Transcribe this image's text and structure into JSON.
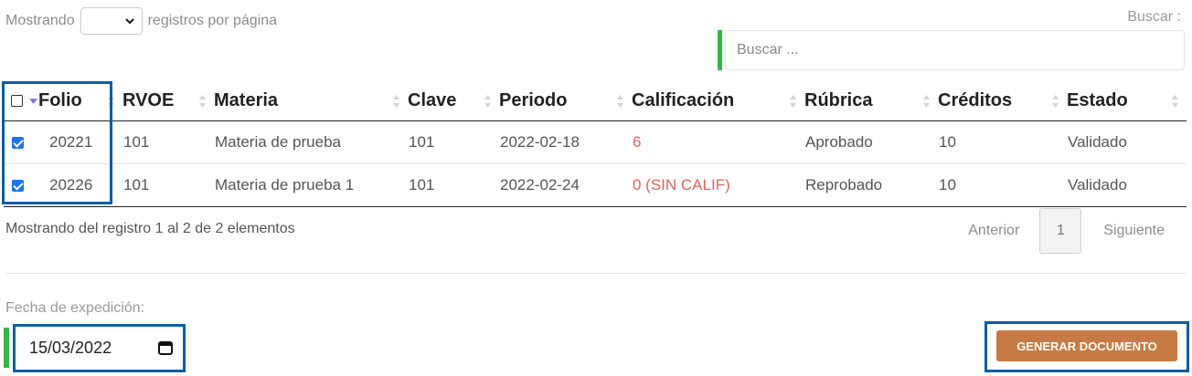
{
  "length_menu": {
    "prefix": "Mostrando",
    "suffix": "registros por página",
    "selected": ""
  },
  "search": {
    "label": "Buscar :",
    "placeholder": "Buscar ..."
  },
  "table": {
    "columns": [
      "Folio",
      "RVOE",
      "Materia",
      "Clave",
      "Periodo",
      "Calificación",
      "Rúbrica",
      "Créditos",
      "Estado"
    ],
    "rows": [
      {
        "checked": true,
        "folio": "20221",
        "rvoe": "101",
        "materia": "Materia de prueba",
        "clave": "101",
        "periodo": "2022-02-18",
        "calificacion": "6",
        "rubrica": "Aprobado",
        "creditos": "10",
        "estado": "Validado"
      },
      {
        "checked": true,
        "folio": "20226",
        "rvoe": "101",
        "materia": "Materia de prueba 1",
        "clave": "101",
        "periodo": "2022-02-24",
        "calificacion": "0 (SIN CALIF)",
        "rubrica": "Reprobado",
        "creditos": "10",
        "estado": "Validado"
      }
    ]
  },
  "info": "Mostrando del registro 1 al 2 de 2 elementos",
  "pagination": {
    "previous": "Anterior",
    "current": "1",
    "next": "Siguiente"
  },
  "date": {
    "label": "Fecha de expedición:",
    "value": "15/03/2022"
  },
  "generate_button": "GENERAR DOCUMENTO",
  "colors": {
    "accent_green": "#35b64a",
    "button": "#c87a44",
    "highlight": "#0a5ea8",
    "grade_red": "#e0645a"
  },
  "icons": {
    "select_arrow": "chevron-down-icon",
    "sort": "sort-icon",
    "calendar": "calendar-icon"
  }
}
